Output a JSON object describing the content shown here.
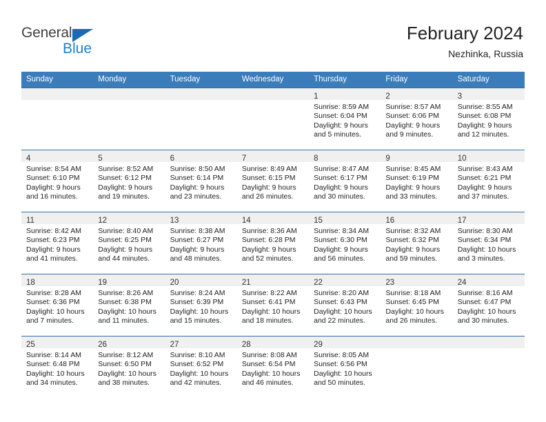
{
  "brand": {
    "name_part1": "General",
    "name_part2": "Blue",
    "triangle_color": "#1a6bb5",
    "blue_color": "#1a7fd4"
  },
  "header": {
    "title": "February 2024",
    "subtitle": "Nezhinka, Russia"
  },
  "colors": {
    "header_row_bg": "#3b7cba",
    "row_separator": "#2f6ea8",
    "daynum_band_bg": "#f0f0f0",
    "text": "#222222"
  },
  "weekday_headers": [
    "Sunday",
    "Monday",
    "Tuesday",
    "Wednesday",
    "Thursday",
    "Friday",
    "Saturday"
  ],
  "weeks": [
    [
      {
        "day": "",
        "sunrise": "",
        "sunset": "",
        "daylight_line1": "",
        "daylight_line2": ""
      },
      {
        "day": "",
        "sunrise": "",
        "sunset": "",
        "daylight_line1": "",
        "daylight_line2": ""
      },
      {
        "day": "",
        "sunrise": "",
        "sunset": "",
        "daylight_line1": "",
        "daylight_line2": ""
      },
      {
        "day": "",
        "sunrise": "",
        "sunset": "",
        "daylight_line1": "",
        "daylight_line2": ""
      },
      {
        "day": "1",
        "sunrise": "Sunrise: 8:59 AM",
        "sunset": "Sunset: 6:04 PM",
        "daylight_line1": "Daylight: 9 hours",
        "daylight_line2": "and 5 minutes."
      },
      {
        "day": "2",
        "sunrise": "Sunrise: 8:57 AM",
        "sunset": "Sunset: 6:06 PM",
        "daylight_line1": "Daylight: 9 hours",
        "daylight_line2": "and 9 minutes."
      },
      {
        "day": "3",
        "sunrise": "Sunrise: 8:55 AM",
        "sunset": "Sunset: 6:08 PM",
        "daylight_line1": "Daylight: 9 hours",
        "daylight_line2": "and 12 minutes."
      }
    ],
    [
      {
        "day": "4",
        "sunrise": "Sunrise: 8:54 AM",
        "sunset": "Sunset: 6:10 PM",
        "daylight_line1": "Daylight: 9 hours",
        "daylight_line2": "and 16 minutes."
      },
      {
        "day": "5",
        "sunrise": "Sunrise: 8:52 AM",
        "sunset": "Sunset: 6:12 PM",
        "daylight_line1": "Daylight: 9 hours",
        "daylight_line2": "and 19 minutes."
      },
      {
        "day": "6",
        "sunrise": "Sunrise: 8:50 AM",
        "sunset": "Sunset: 6:14 PM",
        "daylight_line1": "Daylight: 9 hours",
        "daylight_line2": "and 23 minutes."
      },
      {
        "day": "7",
        "sunrise": "Sunrise: 8:49 AM",
        "sunset": "Sunset: 6:15 PM",
        "daylight_line1": "Daylight: 9 hours",
        "daylight_line2": "and 26 minutes."
      },
      {
        "day": "8",
        "sunrise": "Sunrise: 8:47 AM",
        "sunset": "Sunset: 6:17 PM",
        "daylight_line1": "Daylight: 9 hours",
        "daylight_line2": "and 30 minutes."
      },
      {
        "day": "9",
        "sunrise": "Sunrise: 8:45 AM",
        "sunset": "Sunset: 6:19 PM",
        "daylight_line1": "Daylight: 9 hours",
        "daylight_line2": "and 33 minutes."
      },
      {
        "day": "10",
        "sunrise": "Sunrise: 8:43 AM",
        "sunset": "Sunset: 6:21 PM",
        "daylight_line1": "Daylight: 9 hours",
        "daylight_line2": "and 37 minutes."
      }
    ],
    [
      {
        "day": "11",
        "sunrise": "Sunrise: 8:42 AM",
        "sunset": "Sunset: 6:23 PM",
        "daylight_line1": "Daylight: 9 hours",
        "daylight_line2": "and 41 minutes."
      },
      {
        "day": "12",
        "sunrise": "Sunrise: 8:40 AM",
        "sunset": "Sunset: 6:25 PM",
        "daylight_line1": "Daylight: 9 hours",
        "daylight_line2": "and 44 minutes."
      },
      {
        "day": "13",
        "sunrise": "Sunrise: 8:38 AM",
        "sunset": "Sunset: 6:27 PM",
        "daylight_line1": "Daylight: 9 hours",
        "daylight_line2": "and 48 minutes."
      },
      {
        "day": "14",
        "sunrise": "Sunrise: 8:36 AM",
        "sunset": "Sunset: 6:28 PM",
        "daylight_line1": "Daylight: 9 hours",
        "daylight_line2": "and 52 minutes."
      },
      {
        "day": "15",
        "sunrise": "Sunrise: 8:34 AM",
        "sunset": "Sunset: 6:30 PM",
        "daylight_line1": "Daylight: 9 hours",
        "daylight_line2": "and 56 minutes."
      },
      {
        "day": "16",
        "sunrise": "Sunrise: 8:32 AM",
        "sunset": "Sunset: 6:32 PM",
        "daylight_line1": "Daylight: 9 hours",
        "daylight_line2": "and 59 minutes."
      },
      {
        "day": "17",
        "sunrise": "Sunrise: 8:30 AM",
        "sunset": "Sunset: 6:34 PM",
        "daylight_line1": "Daylight: 10 hours",
        "daylight_line2": "and 3 minutes."
      }
    ],
    [
      {
        "day": "18",
        "sunrise": "Sunrise: 8:28 AM",
        "sunset": "Sunset: 6:36 PM",
        "daylight_line1": "Daylight: 10 hours",
        "daylight_line2": "and 7 minutes."
      },
      {
        "day": "19",
        "sunrise": "Sunrise: 8:26 AM",
        "sunset": "Sunset: 6:38 PM",
        "daylight_line1": "Daylight: 10 hours",
        "daylight_line2": "and 11 minutes."
      },
      {
        "day": "20",
        "sunrise": "Sunrise: 8:24 AM",
        "sunset": "Sunset: 6:39 PM",
        "daylight_line1": "Daylight: 10 hours",
        "daylight_line2": "and 15 minutes."
      },
      {
        "day": "21",
        "sunrise": "Sunrise: 8:22 AM",
        "sunset": "Sunset: 6:41 PM",
        "daylight_line1": "Daylight: 10 hours",
        "daylight_line2": "and 18 minutes."
      },
      {
        "day": "22",
        "sunrise": "Sunrise: 8:20 AM",
        "sunset": "Sunset: 6:43 PM",
        "daylight_line1": "Daylight: 10 hours",
        "daylight_line2": "and 22 minutes."
      },
      {
        "day": "23",
        "sunrise": "Sunrise: 8:18 AM",
        "sunset": "Sunset: 6:45 PM",
        "daylight_line1": "Daylight: 10 hours",
        "daylight_line2": "and 26 minutes."
      },
      {
        "day": "24",
        "sunrise": "Sunrise: 8:16 AM",
        "sunset": "Sunset: 6:47 PM",
        "daylight_line1": "Daylight: 10 hours",
        "daylight_line2": "and 30 minutes."
      }
    ],
    [
      {
        "day": "25",
        "sunrise": "Sunrise: 8:14 AM",
        "sunset": "Sunset: 6:48 PM",
        "daylight_line1": "Daylight: 10 hours",
        "daylight_line2": "and 34 minutes."
      },
      {
        "day": "26",
        "sunrise": "Sunrise: 8:12 AM",
        "sunset": "Sunset: 6:50 PM",
        "daylight_line1": "Daylight: 10 hours",
        "daylight_line2": "and 38 minutes."
      },
      {
        "day": "27",
        "sunrise": "Sunrise: 8:10 AM",
        "sunset": "Sunset: 6:52 PM",
        "daylight_line1": "Daylight: 10 hours",
        "daylight_line2": "and 42 minutes."
      },
      {
        "day": "28",
        "sunrise": "Sunrise: 8:08 AM",
        "sunset": "Sunset: 6:54 PM",
        "daylight_line1": "Daylight: 10 hours",
        "daylight_line2": "and 46 minutes."
      },
      {
        "day": "29",
        "sunrise": "Sunrise: 8:05 AM",
        "sunset": "Sunset: 6:56 PM",
        "daylight_line1": "Daylight: 10 hours",
        "daylight_line2": "and 50 minutes."
      },
      {
        "day": "",
        "sunrise": "",
        "sunset": "",
        "daylight_line1": "",
        "daylight_line2": ""
      },
      {
        "day": "",
        "sunrise": "",
        "sunset": "",
        "daylight_line1": "",
        "daylight_line2": ""
      }
    ]
  ]
}
